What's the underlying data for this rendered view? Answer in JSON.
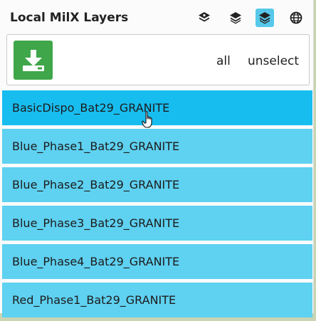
{
  "header": {
    "title": "Local MilX Layers",
    "icons": [
      "layers-icon-1",
      "layers-icon-2",
      "layers-icon-selected",
      "globe-icon"
    ]
  },
  "toolbar": {
    "all_label": "all",
    "unselect_label": "unselect"
  },
  "layers": [
    {
      "label": "BasicDispo_Bat29_GRANITE",
      "hovered": true
    },
    {
      "label": "Blue_Phase1_Bat29_GRANITE",
      "hovered": false
    },
    {
      "label": "Blue_Phase2_Bat29_GRANITE",
      "hovered": false
    },
    {
      "label": "Blue_Phase3_Bat29_GRANITE",
      "hovered": false
    },
    {
      "label": "Blue_Phase4_Bat29_GRANITE",
      "hovered": false
    },
    {
      "label": "Red_Phase1_Bat29_GRANITE",
      "hovered": false
    }
  ],
  "colors": {
    "download_button": "#3fa64a",
    "item_bg": "#5fd1f1",
    "item_hover_bg": "#18bdf0",
    "active_icon_bg": "#58c8ea"
  }
}
